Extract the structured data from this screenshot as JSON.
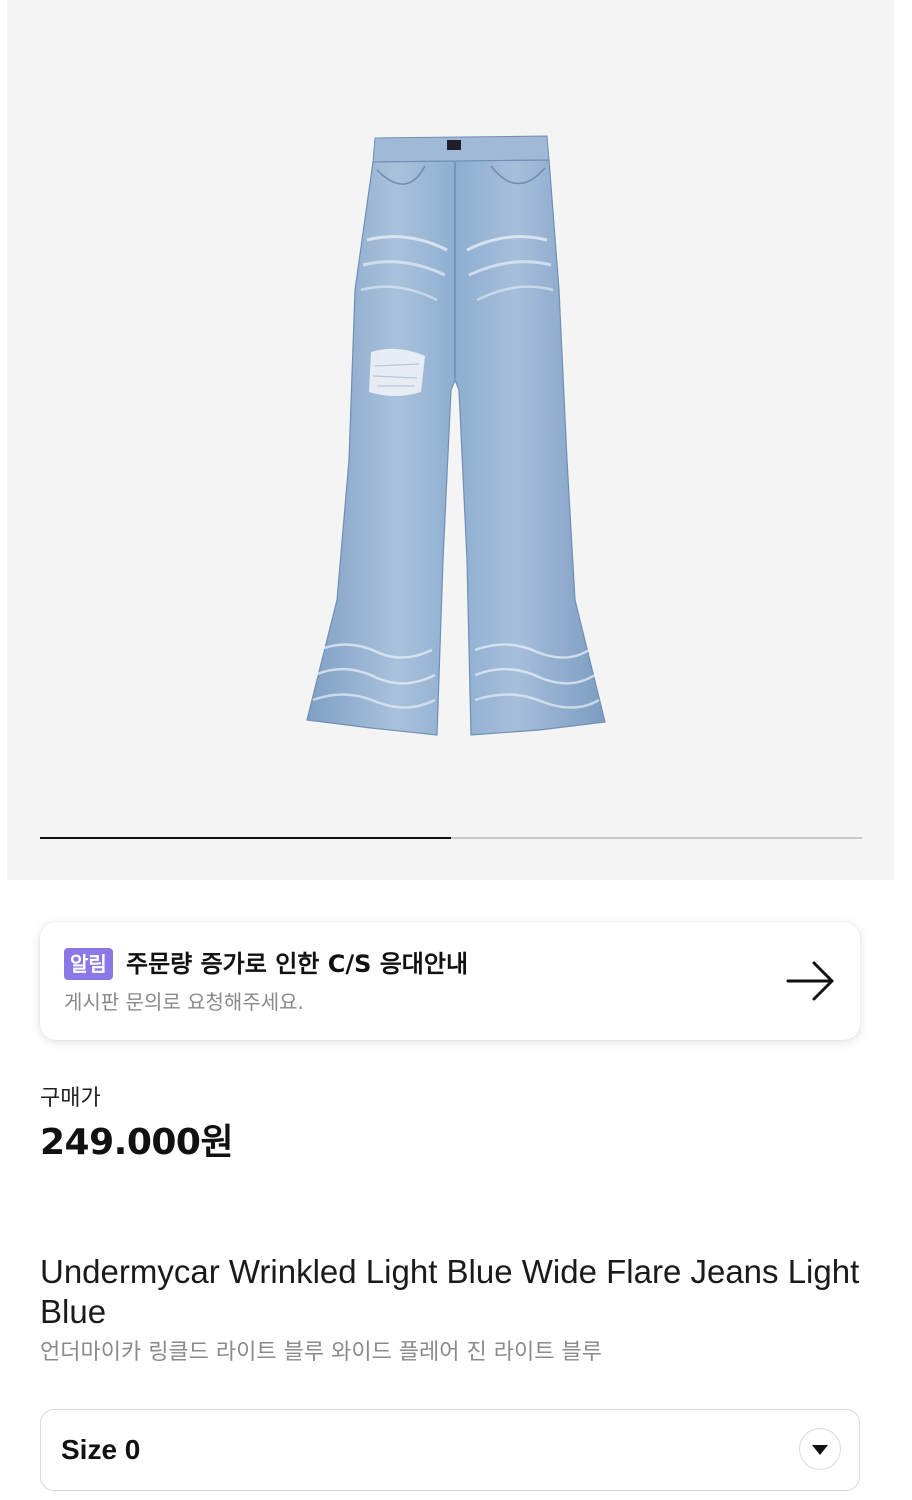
{
  "gallery": {
    "image_alt": "Undermycar Wrinkled Light Blue Wide Flare Jeans",
    "slider_progress": 0.5
  },
  "notice": {
    "badge": "알림",
    "title": "주문량 증가로 인한 C/S 응대안내",
    "subtitle": "게시판 문의로 요청해주세요.",
    "icon": "arrow-right-icon"
  },
  "price": {
    "label": "구매가",
    "value": "249.000원"
  },
  "product": {
    "title": "Undermycar Wrinkled Light Blue Wide Flare Jeans Light Blue",
    "subtitle": "언더마이카 링클드 라이트 블루 와이드 플레어 진 라이트 블루"
  },
  "size_select": {
    "value": "Size 0",
    "icon": "chevron-down-icon"
  },
  "colors": {
    "hero_bg": "#f4f4f5",
    "badge_bg": "#8b78e6",
    "denim": "#8fb0d2"
  }
}
